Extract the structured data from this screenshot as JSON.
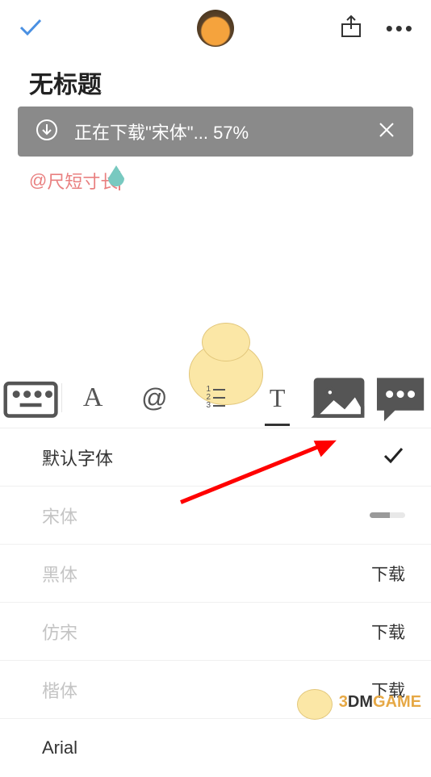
{
  "header": {
    "more_glyph": "•••"
  },
  "document": {
    "title": "无标题",
    "mention_prefix": "@",
    "mention_name": "尺短寸长"
  },
  "download_banner": {
    "text": "正在下载\"宋体\"... 57%"
  },
  "toolbar": {
    "letter_a": "A",
    "at": "@",
    "letter_t": "T"
  },
  "font_panel": {
    "rows": [
      {
        "name": "默认字体",
        "state": "selected"
      },
      {
        "name": "宋体",
        "state": "downloading",
        "progress": 57
      },
      {
        "name": "黑体",
        "state": "download",
        "action_label": "下载"
      },
      {
        "name": "仿宋",
        "state": "download",
        "action_label": "下载"
      },
      {
        "name": "楷体",
        "state": "download",
        "action_label": "下载"
      },
      {
        "name": "Arial",
        "state": "available"
      }
    ]
  },
  "watermark": {
    "text_3": "3",
    "text_dm": "DM",
    "text_game": "GAME"
  }
}
